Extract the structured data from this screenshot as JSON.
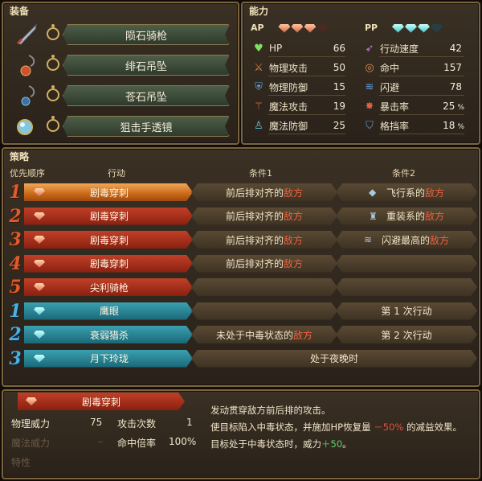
{
  "equipment": {
    "title": "装备",
    "items": [
      {
        "name": "陨石骑枪",
        "icon": "lance-icon"
      },
      {
        "name": "绯石吊坠",
        "icon": "red-pendant-icon"
      },
      {
        "name": "苍石吊坠",
        "icon": "blue-pendant-icon"
      },
      {
        "name": "狙击手透镜",
        "icon": "lens-icon"
      }
    ]
  },
  "ability": {
    "title": "能力",
    "ap_label": "AP",
    "pp_label": "PP",
    "ap": {
      "filled": 3,
      "total": 4
    },
    "pp": {
      "filled": 3,
      "total": 4
    },
    "stats_left": [
      {
        "label": "HP",
        "value": "66",
        "icon": "heart-icon",
        "color": "#80e060"
      },
      {
        "label": "物理攻击",
        "value": "50",
        "icon": "sword-icon",
        "color": "#e08040"
      },
      {
        "label": "物理防御",
        "value": "15",
        "icon": "armor-icon",
        "color": "#60a0e0"
      },
      {
        "label": "魔法攻击",
        "value": "19",
        "icon": "wand-icon",
        "color": "#e07050"
      },
      {
        "label": "魔法防御",
        "value": "25",
        "icon": "robe-icon",
        "color": "#60c0e0"
      }
    ],
    "stats_right": [
      {
        "label": "行动速度",
        "value": "42",
        "unit": "",
        "icon": "speed-icon",
        "color": "#c080e0"
      },
      {
        "label": "命中",
        "value": "157",
        "unit": "",
        "icon": "target-icon",
        "color": "#e09050"
      },
      {
        "label": "闪避",
        "value": "78",
        "unit": "",
        "icon": "evade-icon",
        "color": "#60a0e0"
      },
      {
        "label": "暴击率",
        "value": "25",
        "unit": "%",
        "icon": "crit-icon",
        "color": "#e06040"
      },
      {
        "label": "格挡率",
        "value": "18",
        "unit": "%",
        "icon": "shield-icon",
        "color": "#60a0e0"
      }
    ]
  },
  "strategy": {
    "title": "策略",
    "headers": {
      "priority": "优先顺序",
      "action": "行动",
      "cond1": "条件1",
      "cond2": "条件2"
    },
    "rows": [
      {
        "prio": "1",
        "kind": "ap",
        "style": "sel",
        "action": "剧毒穿刺",
        "c1_pre": "前后排对齐的",
        "c1_hl": "敌方",
        "c2_icon": "flying-icon",
        "c2_pre": "飞行系的",
        "c2_hl": "敌方"
      },
      {
        "prio": "2",
        "kind": "ap",
        "style": "red",
        "action": "剧毒穿刺",
        "c1_pre": "前后排对齐的",
        "c1_hl": "敌方",
        "c2_icon": "armored-icon",
        "c2_pre": "重装系的",
        "c2_hl": "敌方"
      },
      {
        "prio": "3",
        "kind": "ap",
        "style": "red",
        "action": "剧毒穿刺",
        "c1_pre": "前后排对齐的",
        "c1_hl": "敌方",
        "c2_icon": "evade-icon",
        "c2_pre": "闪避最高的",
        "c2_hl": "敌方"
      },
      {
        "prio": "4",
        "kind": "ap",
        "style": "red",
        "action": "剧毒穿刺",
        "c1_pre": "前后排对齐的",
        "c1_hl": "敌方",
        "c2_icon": "",
        "c2_pre": "",
        "c2_hl": ""
      },
      {
        "prio": "5",
        "kind": "ap",
        "style": "red",
        "action": "尖利骑枪",
        "c1_pre": "",
        "c1_hl": "",
        "c2_icon": "",
        "c2_pre": "",
        "c2_hl": ""
      },
      {
        "prio": "1",
        "kind": "pp",
        "style": "blue",
        "action": "鹰眼",
        "c1_pre": "",
        "c1_hl": "",
        "c2_icon": "",
        "c2_pre": "第 1 次行动",
        "c2_hl": ""
      },
      {
        "prio": "2",
        "kind": "pp",
        "style": "blue",
        "action": "衰弱猎杀",
        "c1_pre": "未处于中毒状态的",
        "c1_hl": "敌方",
        "c2_icon": "",
        "c2_pre": "第 2 次行动",
        "c2_hl": ""
      },
      {
        "prio": "3",
        "kind": "pp",
        "style": "blue",
        "action": "月下玲珑",
        "merged": "处于夜晚时"
      }
    ]
  },
  "detail": {
    "skill_name": "剧毒穿刺",
    "phys_power_label": "物理威力",
    "phys_power_value": "75",
    "attacks_label": "攻击次数",
    "attacks_value": "1",
    "magic_power_label": "魔法威力",
    "magic_power_value": "–",
    "hit_mult_label": "命中倍率",
    "hit_mult_value": "100%",
    "trait_label": "特性",
    "desc_line1": "发动贯穿敌方前后排的攻击。",
    "desc_line2_a": "使目标陷入中毒状态，并施加HP恢复量 ",
    "desc_line2_neg": "－50%",
    "desc_line2_b": " 的减益效果。",
    "desc_line3_a": "目标处于中毒状态时，威力",
    "desc_line3_pos": "＋50",
    "desc_line3_b": "。"
  }
}
